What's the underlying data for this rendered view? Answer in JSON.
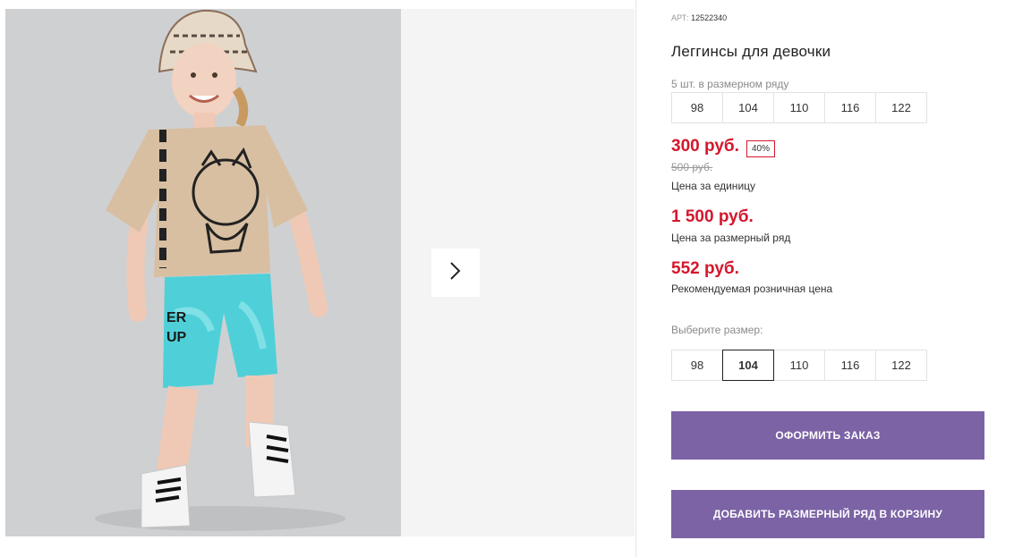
{
  "product": {
    "sku_label": "АРТ:",
    "sku_value": "12522340",
    "title": "Леггинсы для девочки",
    "pack_note": "5 шт. в размерном ряду",
    "pack_sizes": [
      "98",
      "104",
      "110",
      "116",
      "122"
    ],
    "unit_price": "300 руб.",
    "discount": "40%",
    "old_price": "500 руб.",
    "unit_caption": "Цена за единицу",
    "pack_price": "1 500 руб.",
    "pack_caption": "Цена за размерный ряд",
    "retail_price": "552 руб.",
    "retail_caption": "Рекомендуемая розничная цена",
    "choose_label": "Выберите размер:",
    "size_options": [
      "98",
      "104",
      "110",
      "116",
      "122"
    ],
    "selected_size": "104"
  },
  "actions": {
    "order_label": "ОФОРМИТЬ ЗАКАЗ",
    "cart_label": "ДОБАВИТЬ РАЗМЕРНЫЙ РЯД В КОРЗИНУ"
  },
  "colors": {
    "price": "#d4172c",
    "button": "#7b63a5"
  },
  "icons": {
    "next": "chevron-right-icon"
  }
}
